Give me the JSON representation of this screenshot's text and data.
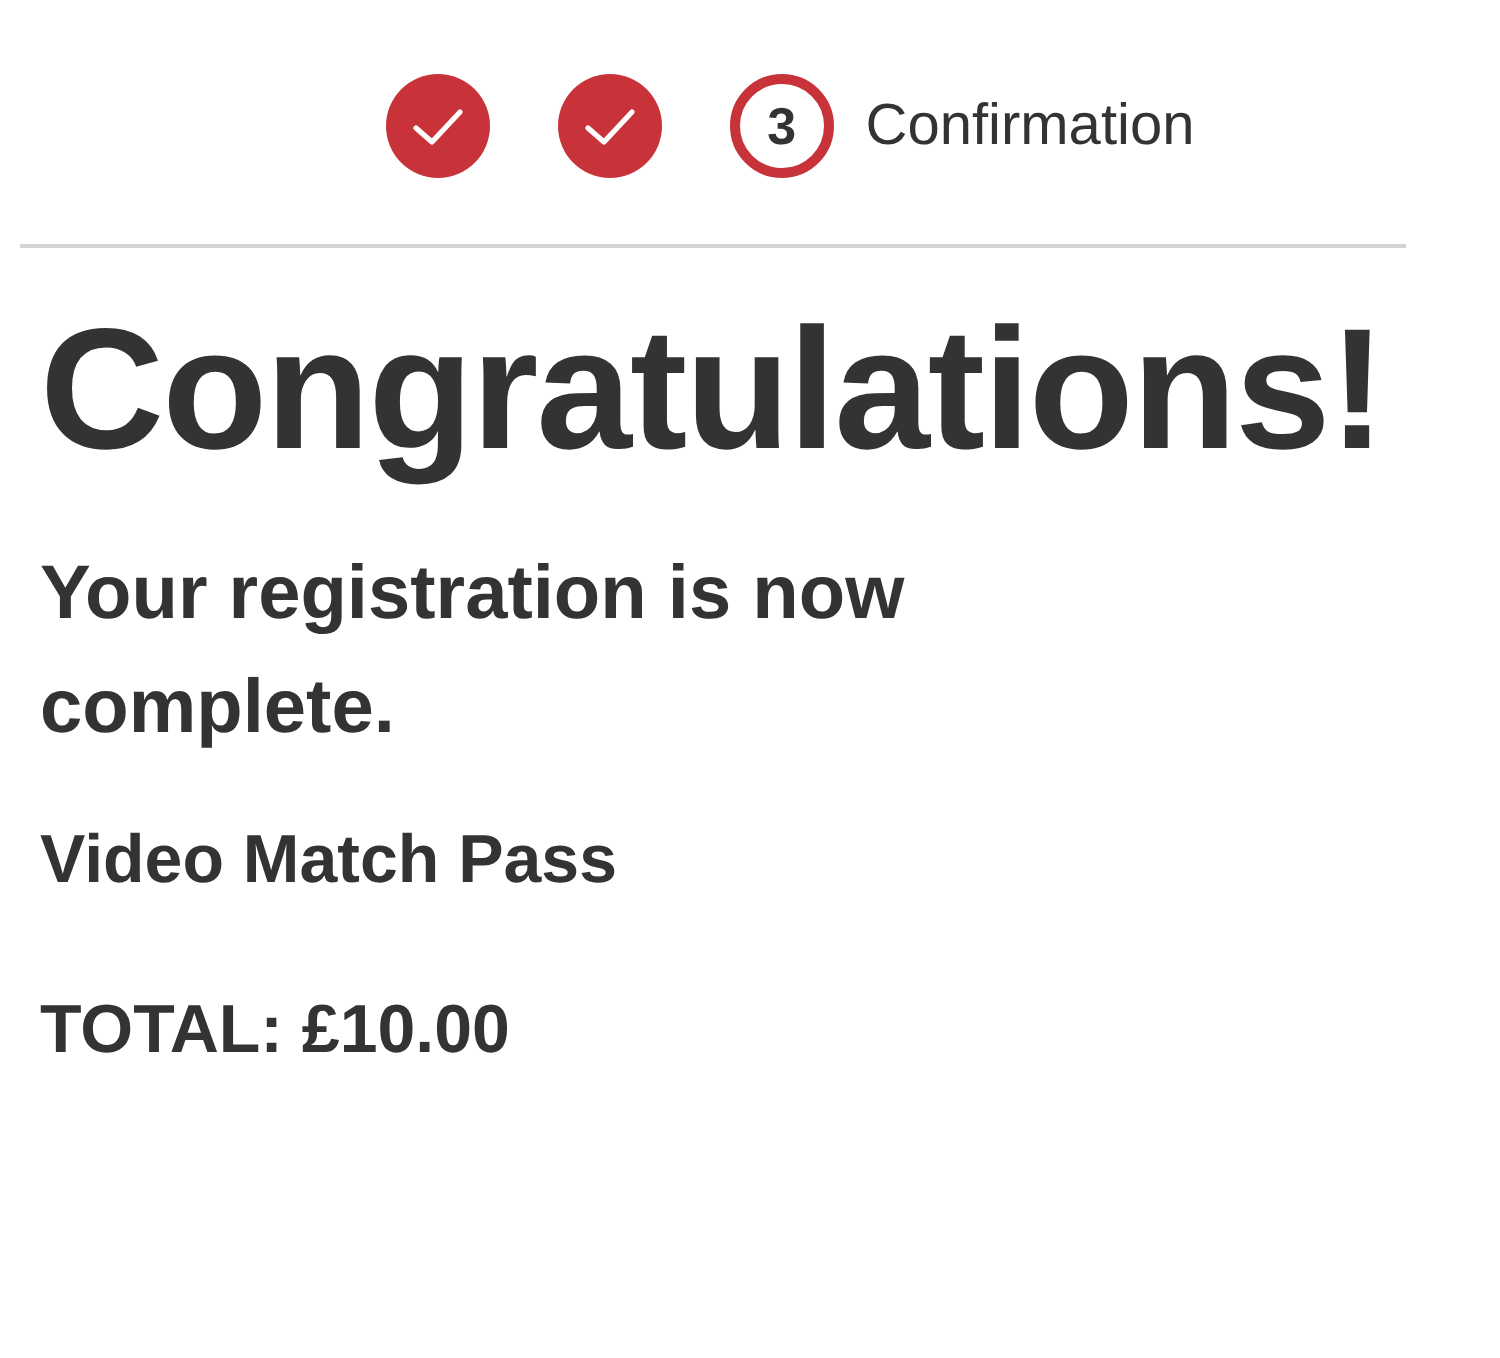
{
  "steps": [
    {
      "completed": true
    },
    {
      "completed": true
    },
    {
      "completed": false,
      "number": "3",
      "label": "Confirmation"
    }
  ],
  "heading": "Congratulations!",
  "message": "Your registration is now complete.",
  "product": "Video Match Pass",
  "total": "TOTAL: £10.00"
}
